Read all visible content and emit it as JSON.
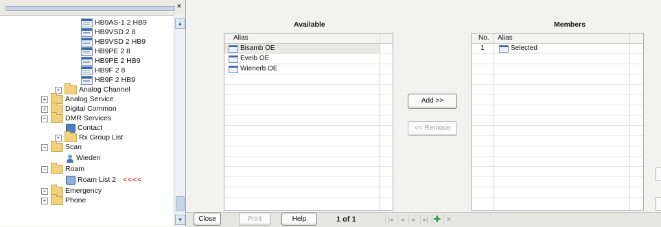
{
  "tree": {
    "close_glyph": "×",
    "items": [
      {
        "label": "HB9AS-1 2 HB9",
        "icon": "channel-doc-icon"
      },
      {
        "label": "HB9VSD 2 8",
        "icon": "channel-doc-icon"
      },
      {
        "label": "HB9VSD 2 HB9",
        "icon": "channel-doc-icon"
      },
      {
        "label": "HB9PE 2 8",
        "icon": "channel-doc-icon"
      },
      {
        "label": "HB9PE 2 HB9",
        "icon": "channel-doc-icon"
      },
      {
        "label": "HB9F 2 8",
        "icon": "channel-doc-icon"
      },
      {
        "label": "HB9F 2 HB9",
        "icon": "channel-doc-icon"
      },
      {
        "label": "Analog Channel",
        "icon": "folder-icon"
      },
      {
        "label": "Analog Service",
        "icon": "folder-icon"
      },
      {
        "label": "Digital Common",
        "icon": "folder-icon"
      },
      {
        "label": "DMR Services",
        "icon": "folder-icon"
      },
      {
        "label": "Contact",
        "icon": "contact-icon"
      },
      {
        "label": "Rx Group List",
        "icon": "folder-icon"
      },
      {
        "label": "Scan",
        "icon": "folder-icon"
      },
      {
        "label": "Wieden",
        "icon": "person-icon"
      },
      {
        "label": "Roam",
        "icon": "folder-icon"
      },
      {
        "label": "Roam List 2",
        "icon": "roam-list-icon"
      },
      {
        "label": "Emergency",
        "icon": "folder-icon"
      },
      {
        "label": "Phone",
        "icon": "folder-icon"
      }
    ],
    "annotation": "<<<<",
    "expand_plus": "+",
    "expand_minus": "−",
    "scroll_up": "▲",
    "scroll_down": "▼"
  },
  "available": {
    "title": "Available",
    "header_alias": "Alias",
    "rows": [
      "Bisamb OE",
      "Evelb OE",
      "Wienerb OE"
    ]
  },
  "members": {
    "title": "Members",
    "header_no": "No.",
    "header_alias": "Alias",
    "rows": [
      {
        "no": "1",
        "alias": "Selected"
      }
    ]
  },
  "buttons": {
    "add": "Add >>",
    "remove": "<< Remove",
    "close": "Close",
    "print": "Print",
    "help": "Help"
  },
  "pager": {
    "text": "1 of 1",
    "first": "|◂",
    "prev": "◂",
    "next": "▸",
    "last": "▸|",
    "add": "✚",
    "delete": "✕"
  },
  "colors": {
    "annotation": "#d23a3a",
    "plus": "#2a9a4a",
    "folder": "#f1d27a"
  }
}
